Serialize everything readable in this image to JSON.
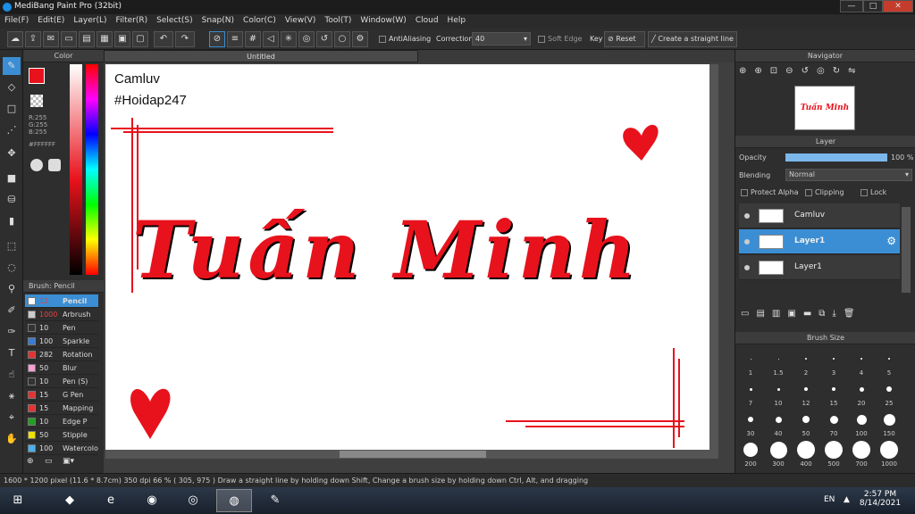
{
  "window": {
    "title": "MediBang Paint Pro (32bit)",
    "min": "—",
    "max": "□",
    "close": "✕"
  },
  "menu": [
    "File(F)",
    "Edit(E)",
    "Layer(L)",
    "Filter(R)",
    "Select(S)",
    "Snap(N)",
    "Color(C)",
    "View(V)",
    "Tool(T)",
    "Window(W)",
    "Cloud",
    "Help"
  ],
  "toolbar": {
    "antialiasing": "AntiAliasing",
    "correction_label": "Correction",
    "correction_value": "40",
    "soft_edge": "Soft Edge",
    "key_label": "Key",
    "reset": "Reset",
    "straight_line": "Create a straight line"
  },
  "color_panel": {
    "title": "Color",
    "r": "R:255",
    "g": "G:255",
    "b": "B:255",
    "hex": "#FFFFFF"
  },
  "brush_panel": {
    "title": "Brush: Pencil",
    "items": [
      {
        "size": "12",
        "name": "Pencil",
        "color": "#ffffff"
      },
      {
        "size": "1000",
        "name": "Arbrush",
        "color": "#cccccc"
      },
      {
        "size": "10",
        "name": "Pen",
        "color": "#333333"
      },
      {
        "size": "100",
        "name": "Sparkle",
        "color": "#3a7bd5"
      },
      {
        "size": "282",
        "name": "Rotation",
        "color": "#e63232"
      },
      {
        "size": "50",
        "name": "Blur",
        "color": "#f5a0d0"
      },
      {
        "size": "10",
        "name": "Pen (S)",
        "color": "#333333"
      },
      {
        "size": "15",
        "name": "G Pen",
        "color": "#e63232"
      },
      {
        "size": "15",
        "name": "Mapping",
        "color": "#e63232"
      },
      {
        "size": "10",
        "name": "Edge P",
        "color": "#22a022"
      },
      {
        "size": "50",
        "name": "Stipple",
        "color": "#f0e000"
      },
      {
        "size": "100",
        "name": "Watercolor",
        "color": "#4ab0f0"
      }
    ]
  },
  "document": {
    "tab": "Untitled",
    "text1": "Camluv",
    "text2": "#Hoidap247",
    "art_text": "Tuấn Minh"
  },
  "navigator": {
    "title": "Navigator",
    "preview": "Tuấn Minh"
  },
  "layer_panel": {
    "title": "Layer",
    "opacity_label": "Opacity",
    "opacity_value": "100 %",
    "opacity_level": 100,
    "blending_label": "Blending",
    "blending_value": "Normal",
    "protect_alpha": "Protect Alpha",
    "clipping": "Clipping",
    "lock": "Lock",
    "layers": [
      {
        "name": "Camluv",
        "selected": false
      },
      {
        "name": "Layer1",
        "selected": true
      },
      {
        "name": "Layer1",
        "selected": false
      }
    ]
  },
  "brush_size": {
    "title": "Brush Size",
    "sizes": [
      "1",
      "1.5",
      "2",
      "3",
      "4",
      "5",
      "7",
      "10",
      "12",
      "15",
      "20",
      "25",
      "30",
      "40",
      "50",
      "70",
      "100",
      "150",
      "200",
      "300",
      "400",
      "500",
      "700",
      "1000"
    ]
  },
  "status": {
    "dimensions": "1600 * 1200 pixel",
    "physical": "(11.6 * 8.7cm)",
    "dpi": "350 dpi",
    "zoom": "66 %",
    "coords": "( 305, 975 )",
    "hint": "Draw a straight line by holding down Shift, Change a brush size by holding down Ctrl, Alt, and dragging"
  },
  "taskbar": {
    "lang": "EN",
    "time": "2:57 PM",
    "date": "8/14/2021"
  },
  "colors": {
    "accent": "#3b8ed3",
    "ink": "#e8121c"
  }
}
